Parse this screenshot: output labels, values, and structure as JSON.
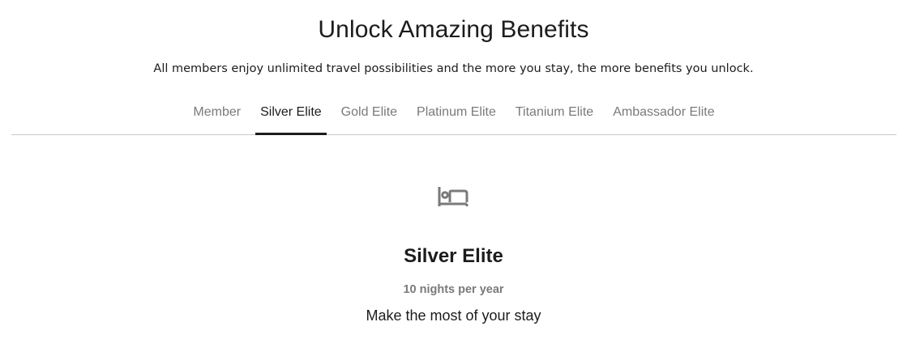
{
  "header": {
    "title": "Unlock Amazing Benefits",
    "subtitle": "All members enjoy unlimited travel possibilities and the more you stay, the more benefits you unlock."
  },
  "tabs": [
    {
      "label": "Member",
      "active": false
    },
    {
      "label": "Silver Elite",
      "active": true
    },
    {
      "label": "Gold Elite",
      "active": false
    },
    {
      "label": "Platinum Elite",
      "active": false
    },
    {
      "label": "Titanium Elite",
      "active": false
    },
    {
      "label": "Ambassador Elite",
      "active": false
    }
  ],
  "tier": {
    "icon": "bed-icon",
    "name": "Silver Elite",
    "nights": "10 nights per year",
    "tagline": "Make the most of your stay"
  },
  "colors": {
    "text_primary": "#1c1c1c",
    "text_muted": "#7a7a7a",
    "divider": "#c8c8c8",
    "icon": "#7a7a7a"
  }
}
